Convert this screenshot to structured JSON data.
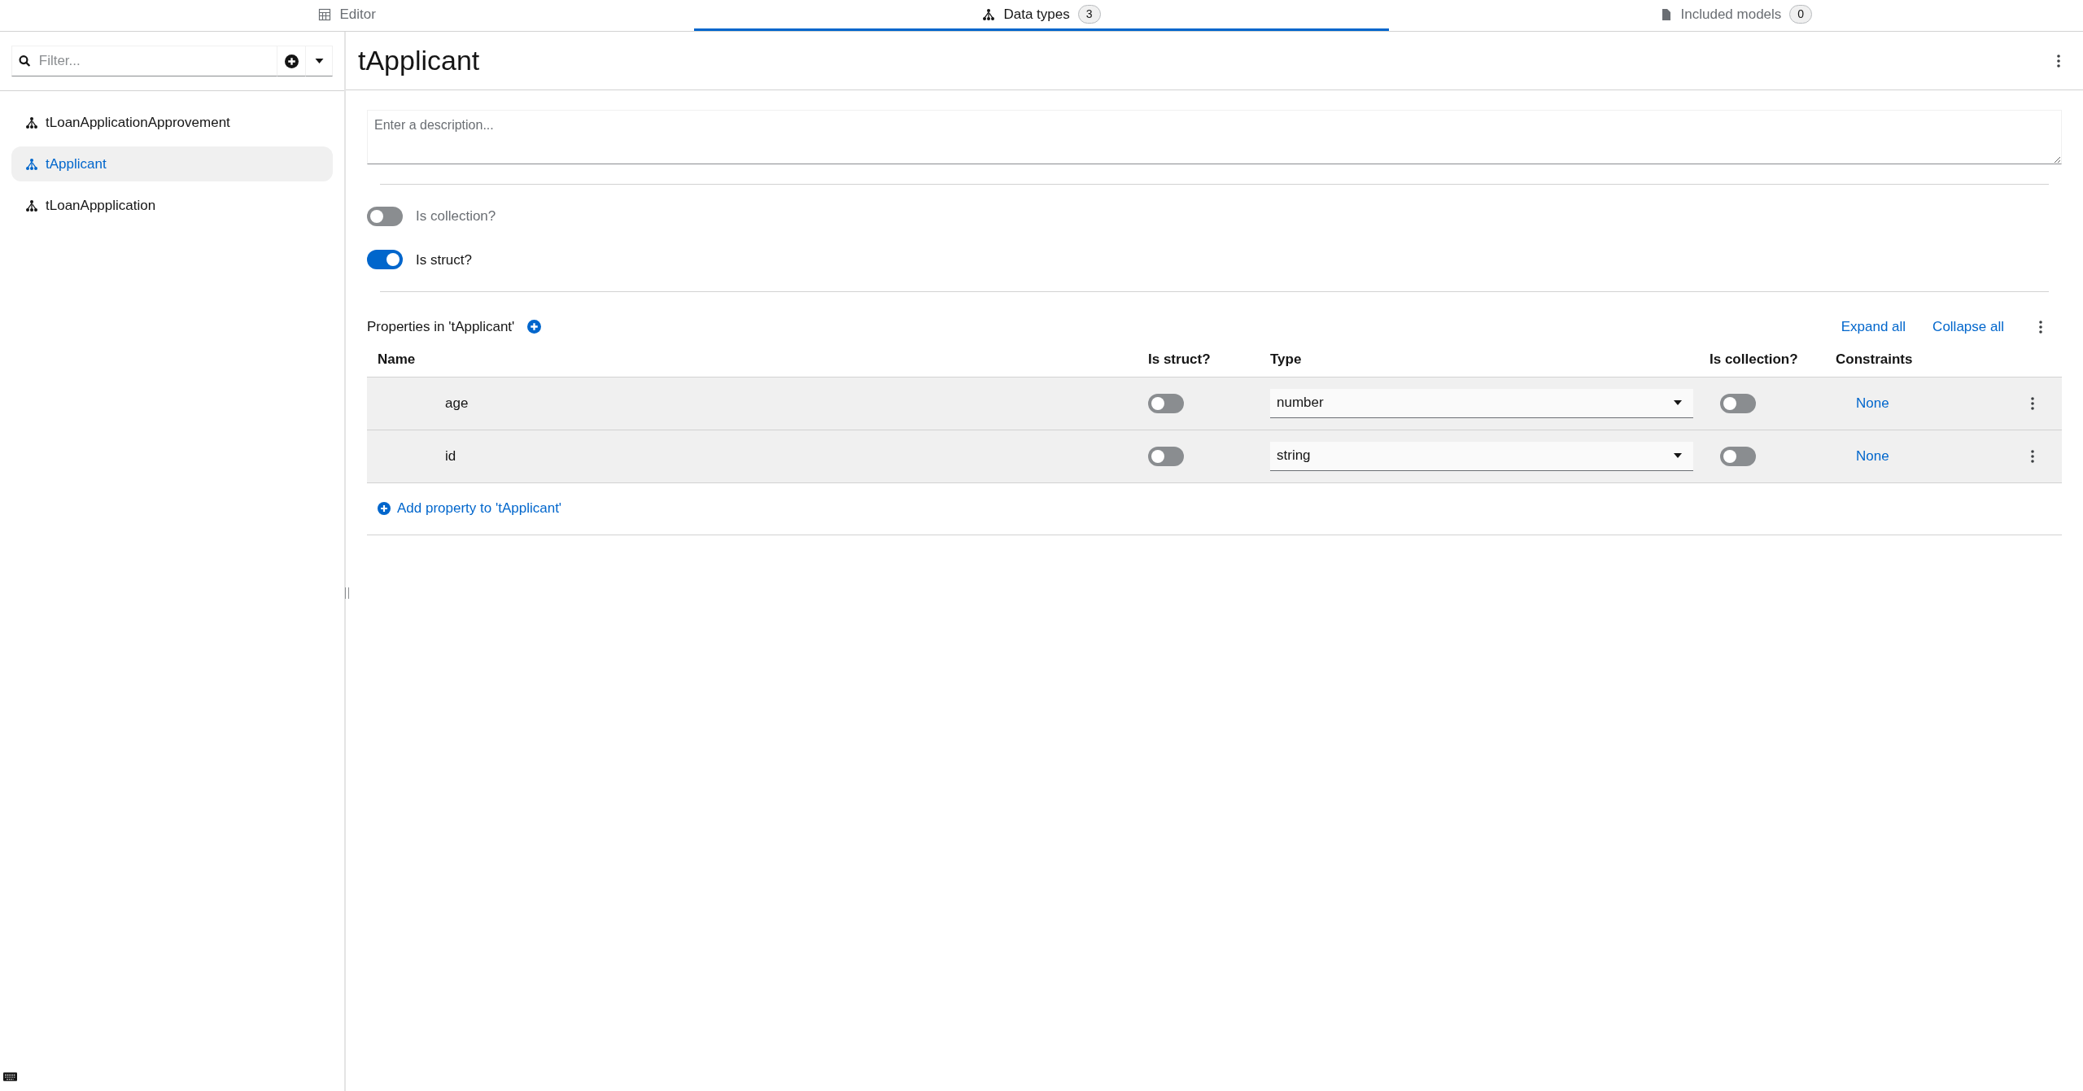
{
  "tabs": [
    {
      "kind": "editor",
      "label": "Editor",
      "selected": false
    },
    {
      "kind": "types",
      "label": "Data types",
      "badge": "3",
      "selected": true
    },
    {
      "kind": "models",
      "label": "Included models",
      "badge": "0",
      "selected": false
    }
  ],
  "sidebar": {
    "filter": {
      "placeholder": "Filter..."
    },
    "items": [
      {
        "label": "tLoanApplicationApprovement",
        "selected": false
      },
      {
        "label": "tApplicant",
        "selected": true
      },
      {
        "label": "tLoanAppplication",
        "selected": false
      }
    ]
  },
  "detail": {
    "title": "tApplicant",
    "description": {
      "placeholder": "Enter a description..."
    },
    "toggles": [
      {
        "label": "Is collection?",
        "on": false
      },
      {
        "label": "Is struct?",
        "on": true
      }
    ],
    "properties": {
      "heading": "Properties in 'tApplicant'",
      "actions": [
        "Expand all",
        "Collapse all"
      ],
      "columns": [
        "Name",
        "Is struct?",
        "Type",
        "Is collection?",
        "Constraints"
      ],
      "rows": [
        {
          "name": "age",
          "is_struct": false,
          "type": "number",
          "is_collection": false,
          "constraints": "None"
        },
        {
          "name": "id",
          "is_struct": false,
          "type": "string",
          "is_collection": false,
          "constraints": "None"
        }
      ],
      "add_label": "Add property to 'tApplicant'"
    }
  }
}
